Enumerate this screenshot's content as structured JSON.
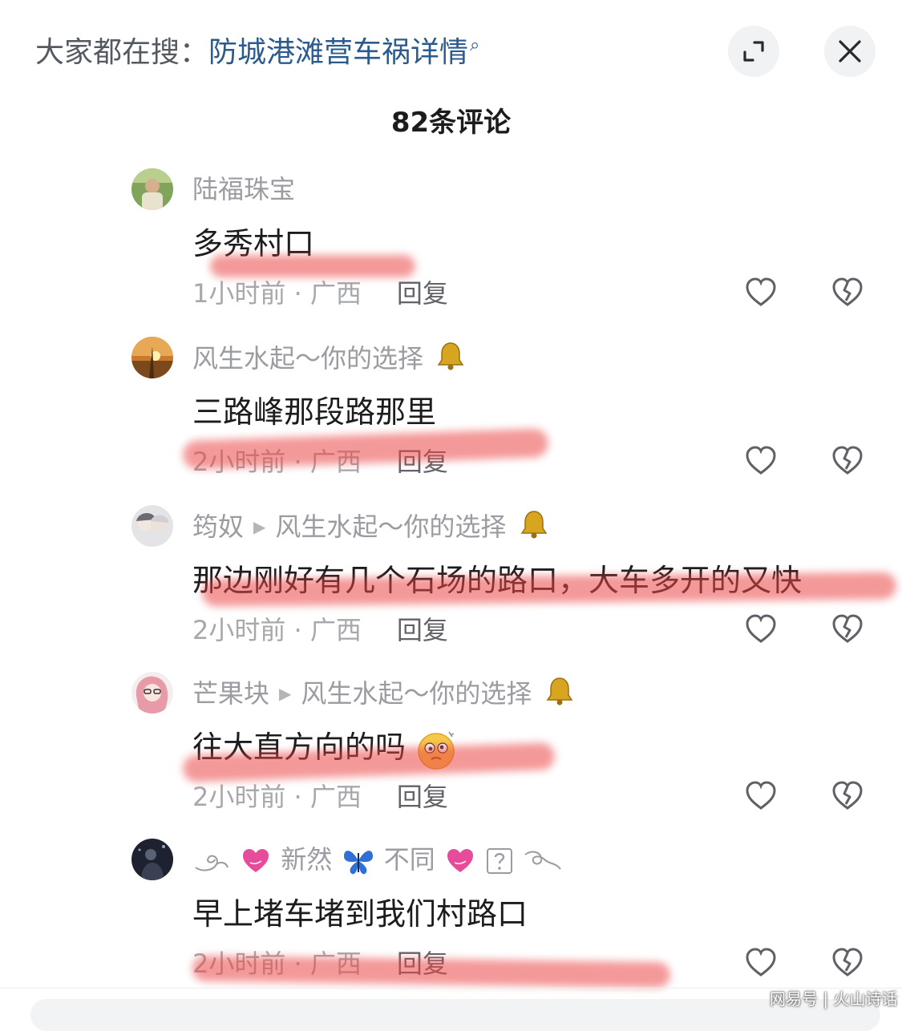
{
  "header": {
    "search_prefix": "大家都在搜：",
    "search_term": "防城港滩营车祸详情",
    "expand_icon": "expand-icon",
    "close_icon": "close-icon"
  },
  "comment_count": "82条评论",
  "comments": [
    {
      "user": "陆福珠宝",
      "reply_to": "",
      "text": "多秀村口",
      "time": "1小时前 · 广西",
      "reply_label": "回复"
    },
    {
      "user": "风生水起～你的选择",
      "reply_to": "",
      "text": "三路峰那段路那里",
      "time": "2小时前 · 广西",
      "reply_label": "回复"
    },
    {
      "user": "筠奴",
      "reply_to": "风生水起～你的选择",
      "text": "那边刚好有几个石场的路口，大车多开的又快",
      "time": "2小时前 · 广西",
      "reply_label": "回复"
    },
    {
      "user": "芒果块",
      "reply_to": "风生水起～你的选择",
      "text": "往大直方向的吗",
      "time": "2小时前 · 广西",
      "reply_label": "回复"
    },
    {
      "user_parts": [
        "新然",
        "不同"
      ],
      "text": "早上堵车堵到我们村路口",
      "time": "2小时前 · 广西",
      "reply_label": "回复"
    }
  ],
  "watermark": "网易号 | 火山诗话",
  "colors": {
    "link": "#2b5b8e",
    "muted": "#a6a8ac",
    "scribble": "#eb4646"
  }
}
